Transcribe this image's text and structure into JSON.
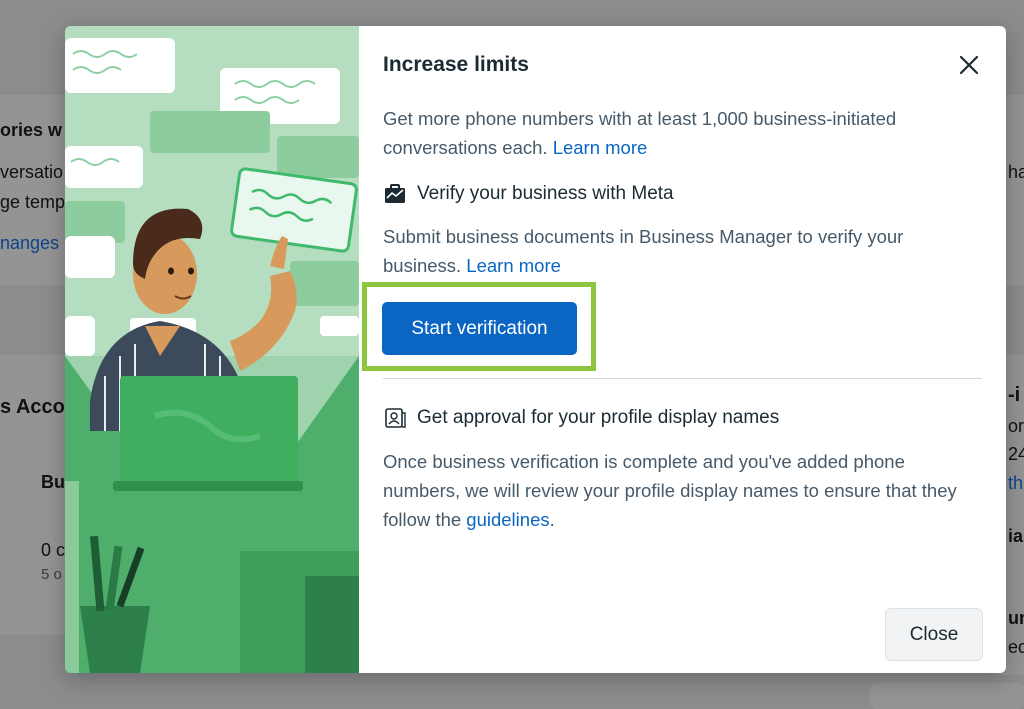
{
  "background": {
    "heading_fragment": "ories w",
    "line1_fragment": "versatio",
    "line2_fragment": "ge temp",
    "link_fragment": "nanges",
    "right_fragment": "ha",
    "account_fragment": "s Acco",
    "column_fragment": "Bu",
    "value_fragment": "0 c",
    "subvalue_fragment": "5 o",
    "right2_fragment": "-i",
    "right3_fragment": "or",
    "right4_fragment": "24",
    "right5_fragment": "th",
    "right6_fragment": "ia",
    "right7_fragment": "un",
    "right8_fragment": "ed"
  },
  "modal": {
    "title": "Increase limits",
    "intro_text": "Get more phone numbers with at least 1,000 business-initiated conversations each.",
    "intro_link": "Learn more",
    "verify": {
      "title": "Verify your business with Meta",
      "description": "Submit business documents in Business Manager to verify your business.",
      "link": "Learn more",
      "button": "Start verification"
    },
    "approval": {
      "title": "Get approval for your profile display names",
      "description": "Once business verification is complete and you've added phone numbers, we will review your profile display names to ensure that they follow the",
      "link": "guidelines",
      "end": "."
    },
    "close_button": "Close"
  },
  "colors": {
    "primary": "#0a66c2",
    "highlight": "#8cc63f",
    "illustration_bg": "#9fd3ad"
  }
}
